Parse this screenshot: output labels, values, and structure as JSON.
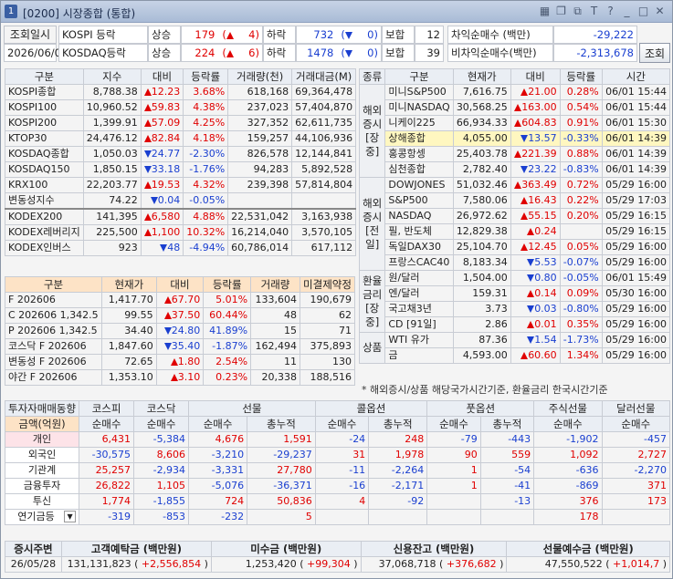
{
  "window": {
    "num": "1",
    "title": "[0200] 시장종합 (통합)"
  },
  "query": {
    "date_label": "조회일시",
    "date": "2026/06/01",
    "button": "조회"
  },
  "index_top": [
    {
      "name": "KOSPI 등락",
      "up_label": "상승",
      "up": "179",
      "up_chg": "4",
      "dn_label": "하락",
      "dn": "732",
      "dn_chg": "0",
      "flat_label": "보합",
      "flat": "12"
    },
    {
      "name": "KOSDAQ등락",
      "up_label": "상승",
      "up": "224",
      "up_chg": "6",
      "dn_label": "하락",
      "dn": "1478",
      "dn_chg": "0",
      "flat_label": "보합",
      "flat": "39"
    }
  ],
  "program": {
    "arb_label": "차익순매수 (백만)",
    "arb": "-29,222",
    "nonarb_label": "비차익순매수(백만)",
    "nonarb": "-2,313,678"
  },
  "indices": {
    "headers": [
      "구분",
      "지수",
      "대비",
      "등락률",
      "거래량(천)",
      "거래대금(M)"
    ],
    "rows": [
      [
        "KOSPI종합",
        "8,788.38",
        "up",
        "12.23",
        "3.68%",
        "618,168",
        "69,364,478"
      ],
      [
        "KOSPI100",
        "10,960.52",
        "up",
        "59.83",
        "4.38%",
        "237,023",
        "57,404,870"
      ],
      [
        "KOSPI200",
        "1,399.91",
        "up",
        "57.09",
        "4.25%",
        "327,352",
        "62,611,735"
      ],
      [
        "KTOP30",
        "24,476.12",
        "up",
        "82.84",
        "4.18%",
        "159,257",
        "44,106,936"
      ],
      [
        "KOSDAQ종합",
        "1,050.03",
        "dn",
        "24.77",
        "-2.30%",
        "826,578",
        "12,144,841"
      ],
      [
        "KOSDAQ150",
        "1,850.15",
        "dn",
        "33.18",
        "-1.76%",
        "94,283",
        "5,892,528"
      ],
      [
        "KRX100",
        "22,203.77",
        "up",
        "19.53",
        "4.32%",
        "239,398",
        "57,814,804"
      ],
      [
        "변동성지수",
        "74.22",
        "dn",
        "0.04",
        "-0.05%",
        "",
        ""
      ],
      [
        "KODEX200",
        "141,395",
        "up",
        "6,580",
        "4.88%",
        "22,531,042",
        "3,163,938"
      ],
      [
        "KODEX레버리지",
        "225,500",
        "up",
        "1,100",
        "10.32%",
        "16,214,040",
        "3,570,105"
      ],
      [
        "KODEX인버스",
        "923",
        "dn",
        "48",
        "-4.94%",
        "60,786,014",
        "617,112"
      ]
    ]
  },
  "futures": {
    "headers": [
      "구분",
      "현재가",
      "대비",
      "등락률",
      "거래량",
      "미결제약정"
    ],
    "rows": [
      [
        "F 202606",
        "1,417.70",
        "up",
        "67.70",
        "5.01%",
        "133,604",
        "190,679"
      ],
      [
        "C 202606 1,342.5",
        "99.55",
        "up",
        "37.50",
        "60.44%",
        "48",
        "62"
      ],
      [
        "P 202606 1,342.5",
        "34.40",
        "dn",
        "24.80",
        "41.89%",
        "15",
        "71"
      ],
      [
        "코스닥 F 202606",
        "1,847.60",
        "dn",
        "35.40",
        "-1.87%",
        "162,494",
        "375,893"
      ],
      [
        "변동성 F 202606",
        "72.65",
        "up",
        "1.80",
        "2.54%",
        "11",
        "130"
      ],
      [
        "야간 F 202606",
        "1,353.10",
        "up",
        "3.10",
        "0.23%",
        "20,338",
        "188,516"
      ]
    ]
  },
  "world": {
    "headers": [
      "종류",
      "구분",
      "현재가",
      "대비",
      "등락률",
      "시간"
    ],
    "groups": [
      {
        "name": "해외\n증시\n[장중]",
        "rows": [
          [
            "미니S&P500",
            "7,616.75",
            "up",
            "21.00",
            "0.28%",
            "06/01",
            "15:44"
          ],
          [
            "미니NASDAQ",
            "30,568.25",
            "up",
            "163.00",
            "0.54%",
            "06/01",
            "15:44"
          ],
          [
            "니케이225",
            "66,934.33",
            "up",
            "604.83",
            "0.91%",
            "06/01",
            "15:30"
          ],
          [
            "상해종합",
            "4,055.00",
            "dn",
            "13.57",
            "-0.33%",
            "06/01",
            "14:39"
          ],
          [
            "홍콩항셍",
            "25,403.78",
            "up",
            "221.39",
            "0.88%",
            "06/01",
            "14:39"
          ],
          [
            "심천종합",
            "2,782.40",
            "dn",
            "23.22",
            "-0.83%",
            "06/01",
            "14:39"
          ]
        ]
      },
      {
        "name": "해외\n증시\n[전일]",
        "rows": [
          [
            "DOWJONES",
            "51,032.46",
            "up",
            "363.49",
            "0.72%",
            "05/29",
            "16:00"
          ],
          [
            "S&P500",
            "7,580.06",
            "up",
            "16.43",
            "0.22%",
            "05/29",
            "17:03"
          ],
          [
            "NASDAQ",
            "26,972.62",
            "up",
            "55.15",
            "0.20%",
            "05/29",
            "16:15"
          ],
          [
            "필, 반도체",
            "12,829.38",
            "up",
            "0.24",
            "",
            "05/29",
            "16:15"
          ],
          [
            "독일DAX30",
            "25,104.70",
            "up",
            "12.45",
            "0.05%",
            "05/29",
            "16:00"
          ],
          [
            "프랑스CAC40",
            "8,183.34",
            "dn",
            "5.53",
            "-0.07%",
            "05/29",
            "16:00"
          ]
        ]
      },
      {
        "name": "환율\n금리\n[장중]",
        "rows": [
          [
            "원/달러",
            "1,504.00",
            "dn",
            "0.80",
            "-0.05%",
            "06/01",
            "15:49"
          ],
          [
            "엔/달러",
            "159.31",
            "up",
            "0.14",
            "0.09%",
            "05/30",
            "16:00"
          ],
          [
            "국고채3년",
            "3.73",
            "dn",
            "0.03",
            "-0.80%",
            "05/29",
            "16:00"
          ],
          [
            "CD [91일]",
            "2.86",
            "up",
            "0.01",
            "0.35%",
            "05/29",
            "16:00"
          ]
        ]
      },
      {
        "name": "상품",
        "rows": [
          [
            "WTI 유가",
            "87.36",
            "dn",
            "1.54",
            "-1.73%",
            "05/29",
            "16:00"
          ],
          [
            "금",
            "4,593.00",
            "up",
            "60.60",
            "1.34%",
            "05/29",
            "16:00"
          ]
        ]
      }
    ]
  },
  "world_note": "* 해외증시/상품 해당국가시간기준, 환율금리 한국시간기준",
  "investors": {
    "title": "투자자매매동향",
    "unit": "금액(억원)",
    "col_groups": [
      "코스피",
      "코스닥",
      "선물",
      "콜옵션",
      "풋옵션",
      "주식선물",
      "달러선물"
    ],
    "sub": [
      "순매수",
      "순매수",
      "순매수",
      "총누적",
      "순매수",
      "총누적",
      "순매수",
      "총누적",
      "순매수",
      "순매수"
    ],
    "rows": [
      {
        "name": "개인",
        "v": [
          "6,431",
          "-5,384",
          "4,676",
          "1,591",
          "-24",
          "248",
          "-79",
          "-443",
          "-1,902",
          "-457"
        ]
      },
      {
        "name": "외국인",
        "v": [
          "-30,575",
          "8,606",
          "-3,210",
          "-29,237",
          "31",
          "1,978",
          "90",
          "559",
          "1,092",
          "2,727"
        ]
      },
      {
        "name": "기관계",
        "v": [
          "25,257",
          "-2,934",
          "-3,331",
          "27,780",
          "-11",
          "-2,264",
          "1",
          "-54",
          "-636",
          "-2,270"
        ]
      },
      {
        "name": "금융투자",
        "v": [
          "26,822",
          "1,105",
          "-5,076",
          "-36,371",
          "-16",
          "-2,171",
          "1",
          "-41",
          "-869",
          "371"
        ]
      },
      {
        "name": "투신",
        "v": [
          "1,774",
          "-1,855",
          "724",
          "50,836",
          "4",
          "-92",
          "",
          "-13",
          "376",
          "173"
        ]
      },
      {
        "name": "연기금등",
        "v": [
          "-319",
          "-853",
          "-232",
          "5",
          "",
          "",
          "",
          "",
          "178",
          ""
        ]
      }
    ]
  },
  "market_funds": {
    "headers": [
      "증시주변",
      "고객예탁금 (백만원)",
      "미수금 (백만원)",
      "신용잔고 (백만원)",
      "선물예수금 (백만원)"
    ],
    "date": "26/05/28",
    "deposit": "131,131,823",
    "deposit_chg": "+2,556,854",
    "unpaid": "1,253,420",
    "unpaid_chg": "+99,304",
    "credit": "37,068,718",
    "credit_chg": "+376,682",
    "futdep": "47,550,522",
    "futdep_chg": "+1,014,7"
  }
}
